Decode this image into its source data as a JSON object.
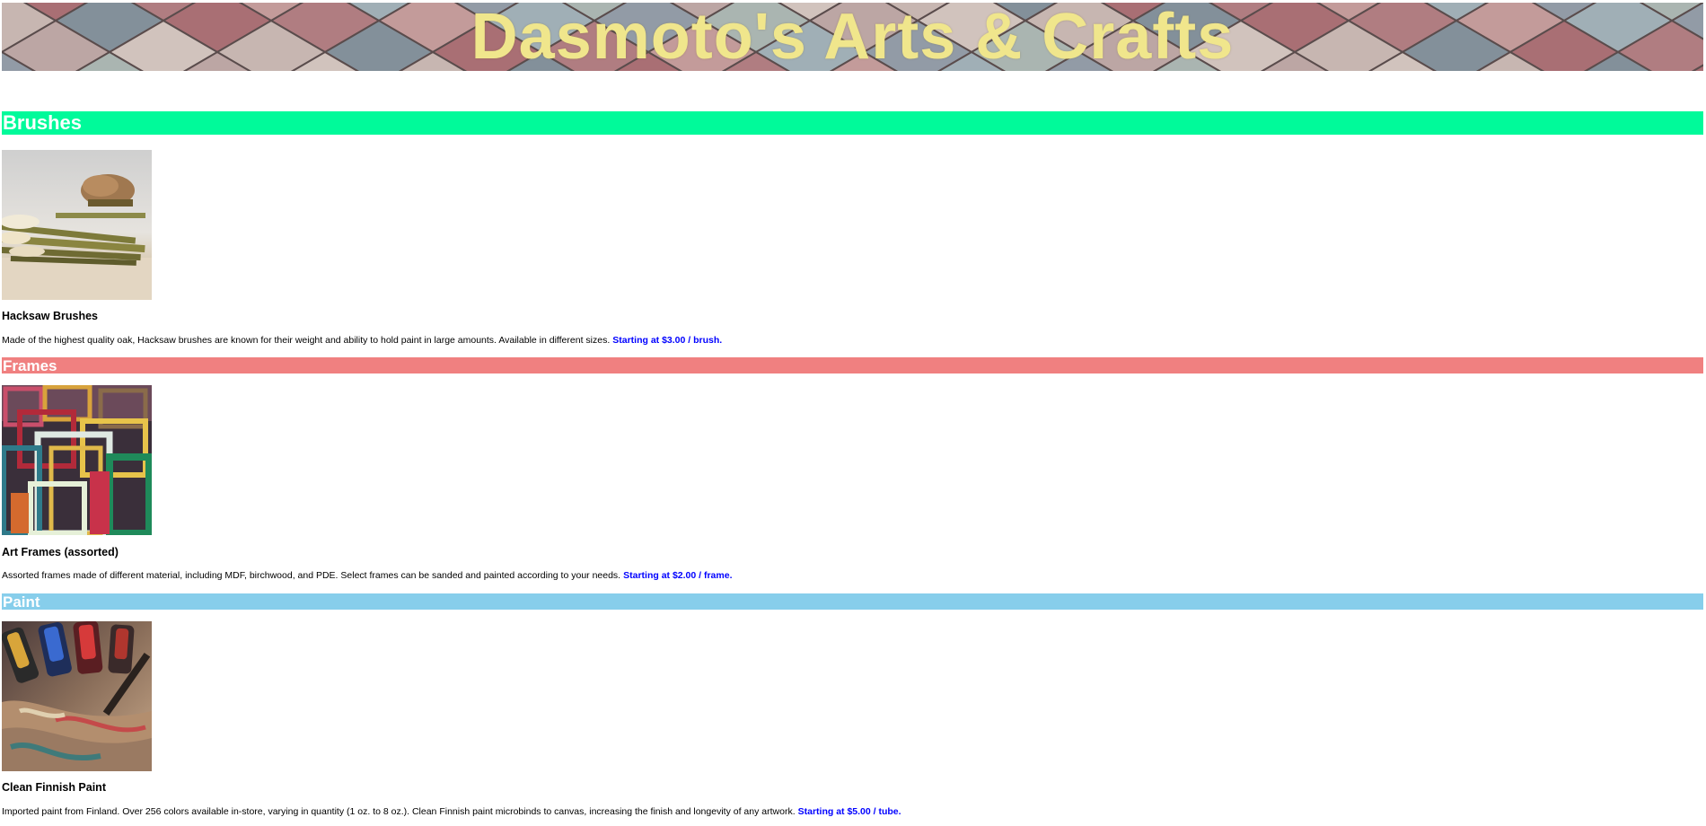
{
  "site": {
    "title": "Dasmoto's Arts & Crafts",
    "title_color": "#f0e68c"
  },
  "sections": [
    {
      "heading": "Brushes",
      "color": "#00fa9a",
      "image_icon": "brushes-photo",
      "product_name": "Hacksaw Brushes",
      "description": "Made of the highest quality oak, Hacksaw brushes are known for their weight and ability to hold paint in large amounts. Available in different sizes.",
      "price": "Starting at $3.00 / brush."
    },
    {
      "heading": "Frames",
      "color": "#f08080",
      "image_icon": "frames-photo",
      "product_name": "Art Frames (assorted)",
      "description": "Assorted frames made of different material, including MDF, birchwood, and PDE. Select frames can be sanded and painted according to your needs.",
      "price": "Starting at $2.00 / frame."
    },
    {
      "heading": "Paint",
      "color": "#87ceeb",
      "image_icon": "paint-photo",
      "product_name": "Clean Finnish Paint",
      "description": "Imported paint from Finland. Over 256 colors available in-store, varying in quantity (1 oz. to 8 oz.). Clean Finnish paint microbinds to canvas, increasing the finish and longevity of any artwork.",
      "price": "Starting at $5.00 / tube."
    }
  ],
  "price_color": "#0000ff",
  "banner_icon": "tiled-roof-background"
}
